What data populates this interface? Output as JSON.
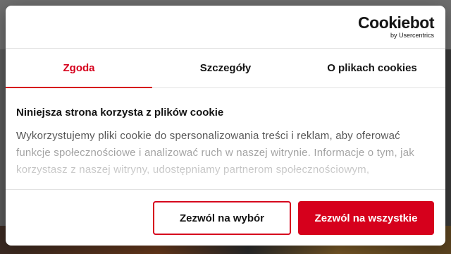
{
  "brand": {
    "logo_text": "Cookiebot",
    "logo_subtext": "by Usercentrics"
  },
  "tabs": [
    {
      "label": "Zgoda",
      "active": true
    },
    {
      "label": "Szczegóły",
      "active": false
    },
    {
      "label": "O plikach cookies",
      "active": false
    }
  ],
  "content": {
    "heading": "Niniejsza strona korzysta z plików cookie",
    "body": "Wykorzystujemy pliki cookie do spersonalizowania treści i reklam, aby oferować funkcje społecznościowe i analizować ruch w naszej witrynie. Informacje o tym, jak korzystasz z naszej witryny, udostępniamy partnerom społecznościowym,"
  },
  "buttons": {
    "allow_selection": "Zezwól na wybór",
    "allow_all": "Zezwól na wszystkie"
  },
  "colors": {
    "accent": "#d6001c",
    "text": "#141414",
    "divider": "#e2e2e2"
  }
}
